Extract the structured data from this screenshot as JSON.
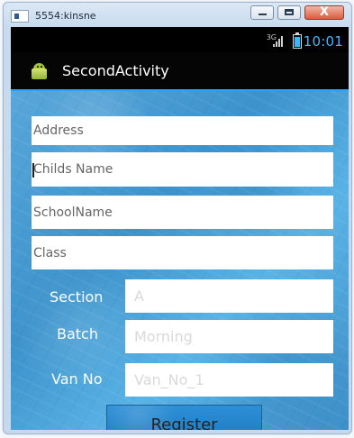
{
  "window": {
    "title": "5554:kinsne",
    "close_label": "X"
  },
  "status_bar": {
    "network": "3G",
    "time": "10:01",
    "icons": [
      "signal-icon",
      "battery-icon"
    ]
  },
  "action_bar": {
    "title": "SecondActivity",
    "icon": "android-icon"
  },
  "form": {
    "address_placeholder": "Address",
    "childs_name_placeholder": "Childs Name",
    "school_name_placeholder": "SchoolName",
    "class_placeholder": "Class",
    "section_label": "Section",
    "section_value": "A",
    "batch_label": "Batch",
    "batch_value": "Morning",
    "van_no_label": "Van No",
    "van_no_value": "Van_No_1",
    "register_label": "Register"
  },
  "colors": {
    "accent": "#2aa0ff",
    "background": "#4a9fd5",
    "status_time": "#41b6ff"
  }
}
